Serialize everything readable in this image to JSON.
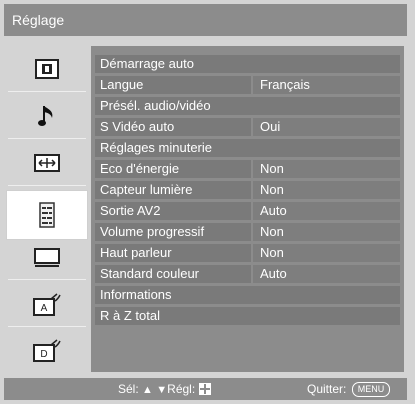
{
  "window": {
    "title": "Réglage"
  },
  "sidebar": {
    "items": [
      {
        "icon": "picture-icon"
      },
      {
        "icon": "music-note-icon"
      },
      {
        "icon": "screen-format-icon"
      },
      {
        "icon": "settings-list-icon",
        "selected": true
      },
      {
        "icon": "monitor-icon"
      },
      {
        "icon": "analog-tv-setup-icon"
      },
      {
        "icon": "digital-tv-setup-icon"
      }
    ]
  },
  "settings": {
    "rows": [
      {
        "label": "Démarrage auto",
        "value": ""
      },
      {
        "label": "Langue",
        "value": "Français"
      },
      {
        "label": "Présél. audio/vidéo",
        "value": ""
      },
      {
        "label": "S Vidéo auto",
        "value": "Oui"
      },
      {
        "label": "Réglages minuterie",
        "value": ""
      },
      {
        "label": "Eco d'énergie",
        "value": "Non"
      },
      {
        "label": "Capteur lumière",
        "value": "Non"
      },
      {
        "label": "Sortie AV2",
        "value": "Auto"
      },
      {
        "label": "Volume progressif",
        "value": "Non"
      },
      {
        "label": "Haut parleur",
        "value": "Non"
      },
      {
        "label": "Standard couleur",
        "value": "Auto"
      },
      {
        "label": "Informations",
        "value": ""
      },
      {
        "label": "R à Z total",
        "value": ""
      }
    ]
  },
  "statusbar": {
    "select_label": "Sél:",
    "adjust_label": "Régl:",
    "quit_label": "Quitter:",
    "menu_button": "MENU"
  },
  "colors": {
    "frame": "#d4d4d4",
    "bar": "#8c8c8c",
    "row_label": "#7a7a7a",
    "row_value": "#7e7e7e"
  }
}
